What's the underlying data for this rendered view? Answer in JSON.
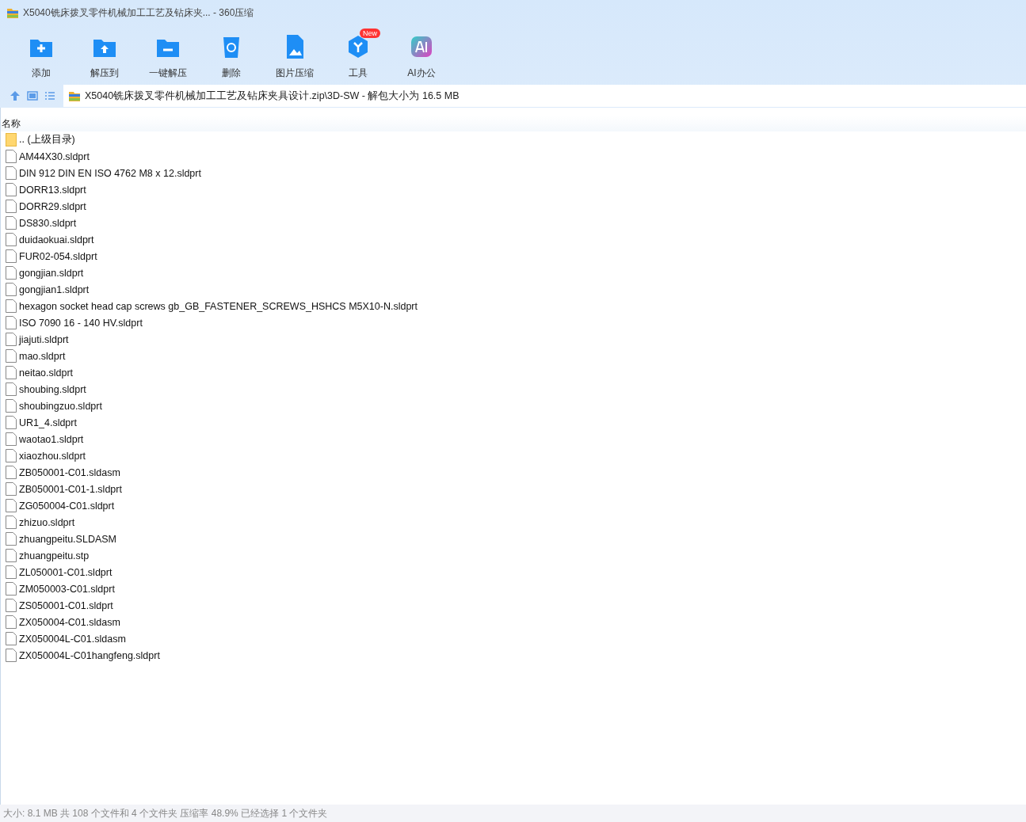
{
  "window": {
    "title": "X5040铣床拨叉零件机械加工工艺及钻床夹... - 360压缩"
  },
  "toolbar": [
    {
      "kind": "add",
      "label": "添加"
    },
    {
      "kind": "extract",
      "label": "解压到"
    },
    {
      "kind": "oneclick",
      "label": "一键解压"
    },
    {
      "kind": "delete",
      "label": "删除"
    },
    {
      "kind": "image",
      "label": "图片压缩"
    },
    {
      "kind": "tools",
      "label": "工具",
      "badge": "New"
    },
    {
      "kind": "ai",
      "label": "AI办公"
    }
  ],
  "address": {
    "path": "X5040铣床拨叉零件机械加工工艺及钻床夹具设计.zip\\3D-SW - 解包大小为 16.5 MB"
  },
  "table": {
    "columns": [
      "名称"
    ],
    "rows": [
      {
        "kind": "folder",
        "name": ".. (上级目录)"
      },
      {
        "kind": "file",
        "name": "AM44X30.sldprt"
      },
      {
        "kind": "file",
        "name": "DIN 912 DIN EN ISO 4762 M8 x 12.sldprt"
      },
      {
        "kind": "file",
        "name": "DORR13.sldprt"
      },
      {
        "kind": "file",
        "name": "DORR29.sldprt"
      },
      {
        "kind": "file",
        "name": "DS830.sldprt"
      },
      {
        "kind": "file",
        "name": "duidaokuai.sldprt"
      },
      {
        "kind": "file",
        "name": "FUR02-054.sldprt"
      },
      {
        "kind": "file",
        "name": "gongjian.sldprt"
      },
      {
        "kind": "file",
        "name": "gongjian1.sldprt"
      },
      {
        "kind": "file",
        "name": "hexagon socket head cap screws gb_GB_FASTENER_SCREWS_HSHCS M5X10-N.sldprt"
      },
      {
        "kind": "file",
        "name": "ISO 7090 16 - 140 HV.sldprt"
      },
      {
        "kind": "file",
        "name": "jiajuti.sldprt"
      },
      {
        "kind": "file",
        "name": "mao.sldprt"
      },
      {
        "kind": "file",
        "name": "neitao.sldprt"
      },
      {
        "kind": "file",
        "name": "shoubing.sldprt"
      },
      {
        "kind": "file",
        "name": "shoubingzuo.sldprt"
      },
      {
        "kind": "file",
        "name": "UR1_4.sldprt"
      },
      {
        "kind": "file",
        "name": "waotao1.sldprt"
      },
      {
        "kind": "file",
        "name": "xiaozhou.sldprt"
      },
      {
        "kind": "file",
        "name": "ZB050001-C01.sldasm"
      },
      {
        "kind": "file",
        "name": "ZB050001-C01-1.sldprt"
      },
      {
        "kind": "file",
        "name": "ZG050004-C01.sldprt"
      },
      {
        "kind": "file",
        "name": "zhizuo.sldprt"
      },
      {
        "kind": "file",
        "name": "zhuangpeitu.SLDASM"
      },
      {
        "kind": "file",
        "name": "zhuangpeitu.stp"
      },
      {
        "kind": "file",
        "name": "ZL050001-C01.sldprt"
      },
      {
        "kind": "file",
        "name": "ZM050003-C01.sldprt"
      },
      {
        "kind": "file",
        "name": "ZS050001-C01.sldprt"
      },
      {
        "kind": "file",
        "name": "ZX050004-C01.sldasm"
      },
      {
        "kind": "file",
        "name": "ZX050004L-C01.sldasm"
      },
      {
        "kind": "file",
        "name": "ZX050004L-C01hangfeng.sldprt"
      }
    ]
  },
  "status_bar": "大小: 8.1 MB 共 108 个文件和 4 个文件夹 压缩率 48.9% 已经选择 1 个文件夹"
}
